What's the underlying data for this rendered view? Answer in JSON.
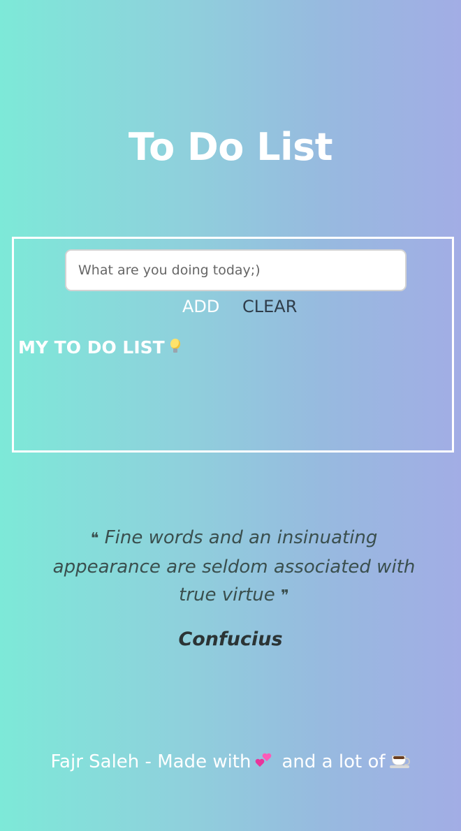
{
  "header": {
    "title": "To Do List"
  },
  "todo": {
    "input_placeholder": "What are you doing today;)",
    "input_value": "",
    "add_label": "ADD",
    "clear_label": "CLEAR",
    "list_heading": "MY TO DO LIST",
    "list_heading_icon": "light-bulb-icon",
    "items": []
  },
  "quote": {
    "open_mark": "❝",
    "text": "Fine words and an insinuating appearance are seldom associated with true virtue",
    "close_mark": "❞",
    "author": "Confucius"
  },
  "footer": {
    "text_before": "Fajr Saleh - Made with",
    "icon_1": "heart-icon",
    "text_middle": "and a lot of",
    "icon_2": "coffee-icon"
  },
  "colors": {
    "gradient_start": "#7de9d8",
    "gradient_end": "#a2ade5",
    "clear_button": "#2f3d4a",
    "quote_text": "#3a4f4e"
  }
}
